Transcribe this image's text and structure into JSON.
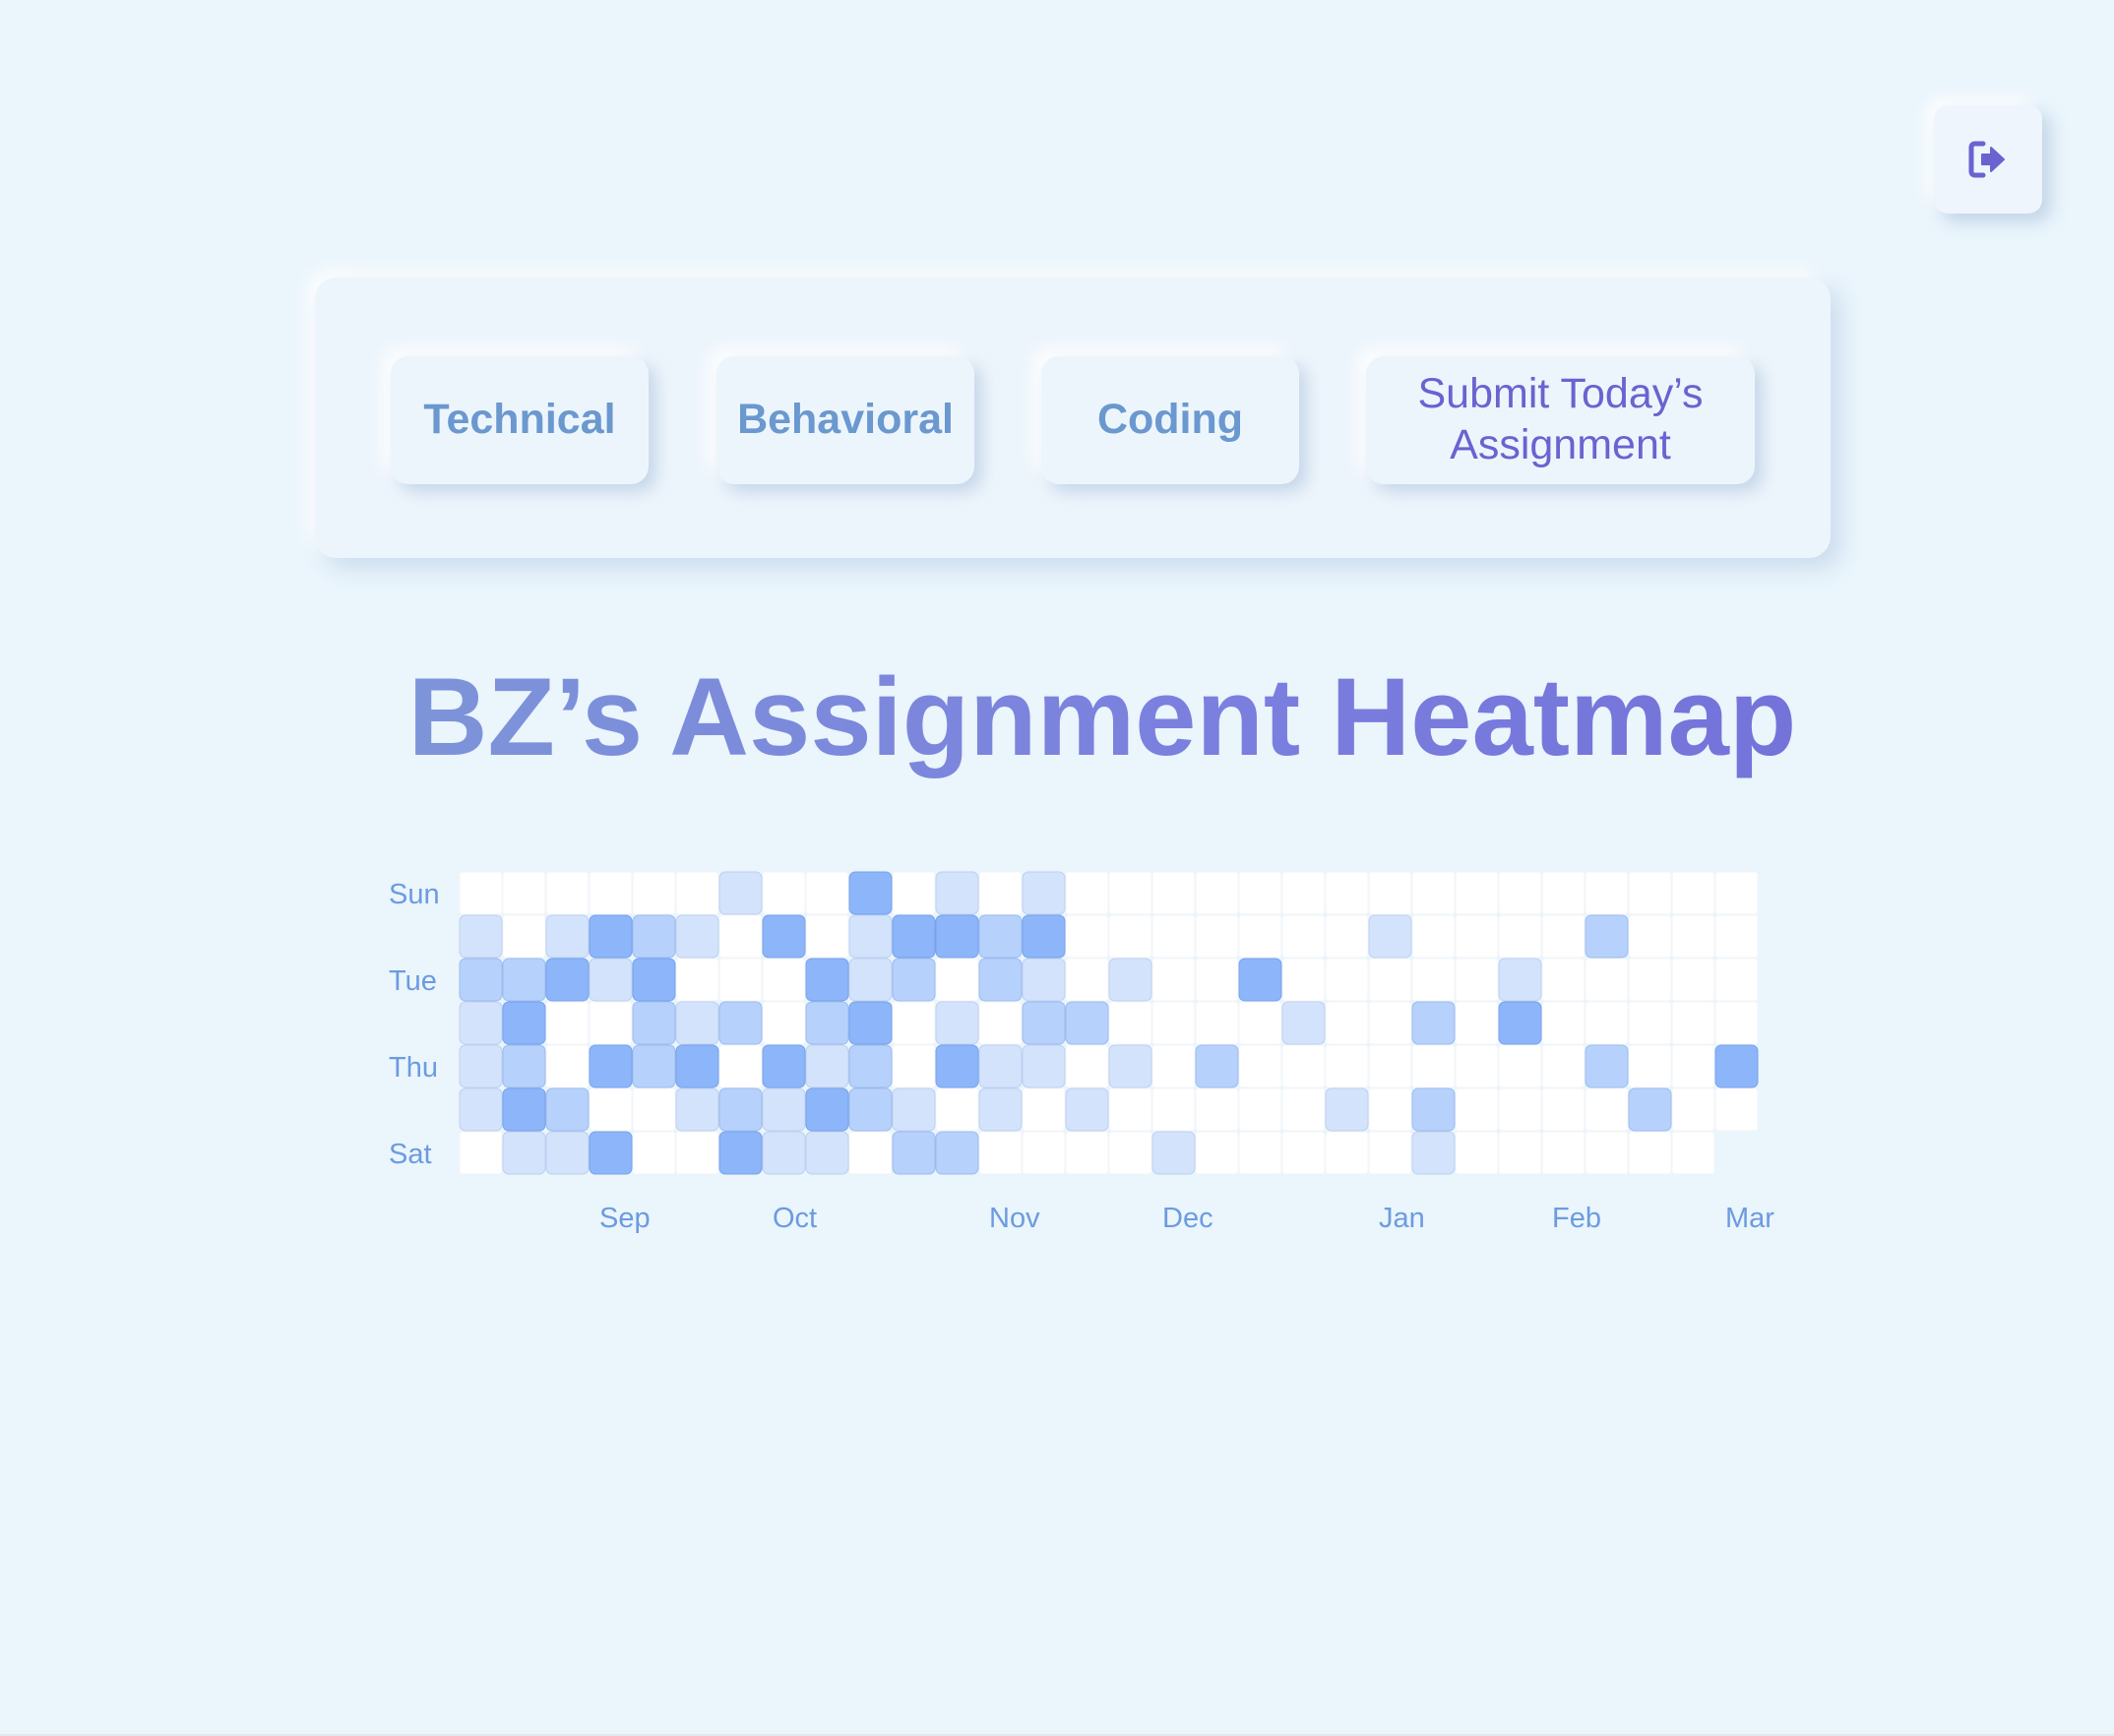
{
  "logout": {
    "icon": "logout-icon",
    "color": "#6a63d0"
  },
  "nav": {
    "technical_label": "Technical",
    "behavioral_label": "Behavioral",
    "coding_label": "Coding",
    "submit_line1": "Submit Today’s",
    "submit_line2": "Assignment"
  },
  "title": "BZ’s Assignment Heatmap",
  "heatmap": {
    "day_labels": [
      {
        "row": 0,
        "text": "Sun"
      },
      {
        "row": 2,
        "text": "Tue"
      },
      {
        "row": 4,
        "text": "Thu"
      },
      {
        "row": 6,
        "text": "Sat"
      }
    ],
    "month_labels": [
      {
        "col": 3,
        "text": "Sep"
      },
      {
        "col": 7,
        "text": "Oct"
      },
      {
        "col": 12,
        "text": "Nov"
      },
      {
        "col": 16,
        "text": "Dec"
      },
      {
        "col": 21,
        "text": "Jan"
      },
      {
        "col": 25,
        "text": "Feb"
      },
      {
        "col": 29,
        "text": "Mar"
      }
    ],
    "level_colors": [
      "#ffffff",
      "#d3e3fb",
      "#b6d1fb",
      "#8cb5fa"
    ],
    "columns": 30,
    "grid": [
      [
        0,
        0,
        0,
        0,
        0,
        0,
        1,
        0,
        0,
        3,
        0,
        1,
        0,
        1,
        0,
        0,
        0,
        0,
        0,
        0,
        0,
        0,
        0,
        0,
        0,
        0,
        0,
        0,
        0,
        0
      ],
      [
        1,
        0,
        1,
        3,
        2,
        1,
        0,
        3,
        0,
        1,
        3,
        3,
        2,
        3,
        0,
        0,
        0,
        0,
        0,
        0,
        0,
        1,
        0,
        0,
        0,
        0,
        2,
        0,
        0,
        0
      ],
      [
        2,
        2,
        3,
        1,
        3,
        0,
        0,
        0,
        3,
        1,
        2,
        0,
        2,
        1,
        0,
        1,
        0,
        0,
        3,
        0,
        0,
        0,
        0,
        0,
        1,
        0,
        0,
        0,
        0,
        0
      ],
      [
        1,
        3,
        0,
        0,
        2,
        1,
        2,
        0,
        2,
        3,
        0,
        1,
        0,
        2,
        2,
        0,
        0,
        0,
        0,
        1,
        0,
        0,
        2,
        0,
        3,
        0,
        0,
        0,
        0,
        0
      ],
      [
        1,
        2,
        0,
        3,
        2,
        3,
        0,
        3,
        1,
        2,
        0,
        3,
        1,
        1,
        0,
        1,
        0,
        2,
        0,
        0,
        0,
        0,
        0,
        0,
        0,
        0,
        2,
        0,
        0,
        3
      ],
      [
        1,
        3,
        2,
        0,
        0,
        1,
        2,
        1,
        3,
        2,
        1,
        0,
        1,
        0,
        1,
        0,
        0,
        0,
        0,
        0,
        1,
        0,
        2,
        0,
        0,
        0,
        0,
        2,
        0,
        0
      ],
      [
        0,
        1,
        1,
        3,
        0,
        0,
        3,
        1,
        1,
        0,
        2,
        2,
        0,
        0,
        0,
        0,
        1,
        0,
        0,
        0,
        0,
        0,
        1,
        0,
        0,
        0,
        0,
        0,
        0,
        null
      ]
    ]
  }
}
